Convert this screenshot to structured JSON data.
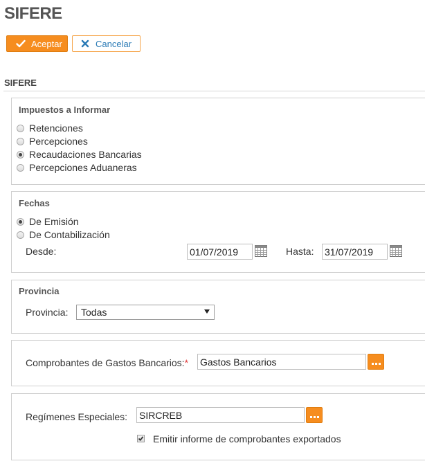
{
  "page": {
    "title": "SIFERE"
  },
  "toolbar": {
    "accept_label": "Aceptar",
    "cancel_label": "Cancelar"
  },
  "section": {
    "title": "SIFERE"
  },
  "impuestos": {
    "title": "Impuestos a Informar",
    "options": [
      {
        "label": "Retenciones",
        "checked": false
      },
      {
        "label": "Percepciones",
        "checked": false
      },
      {
        "label": "Recaudaciones Bancarias",
        "checked": true
      },
      {
        "label": "Percepciones Aduaneras",
        "checked": false
      }
    ]
  },
  "fechas": {
    "title": "Fechas",
    "options": [
      {
        "label": "De Emisión",
        "checked": true
      },
      {
        "label": "De Contabilización",
        "checked": false
      }
    ],
    "desde_label": "Desde:",
    "desde_value": "01/07/2019",
    "hasta_label": "Hasta:",
    "hasta_value": "31/07/2019"
  },
  "provincia": {
    "title": "Provincia",
    "label": "Provincia:",
    "selected": "Todas"
  },
  "gastos": {
    "label": "Comprobantes de Gastos Bancarios:",
    "required_mark": "*",
    "value": "Gastos Bancarios"
  },
  "regimenes": {
    "label": "Regímenes Especiales:",
    "value": "SIRCREB",
    "checkbox_label": "Emitir informe de comprobantes exportados",
    "checkbox_checked": true
  }
}
